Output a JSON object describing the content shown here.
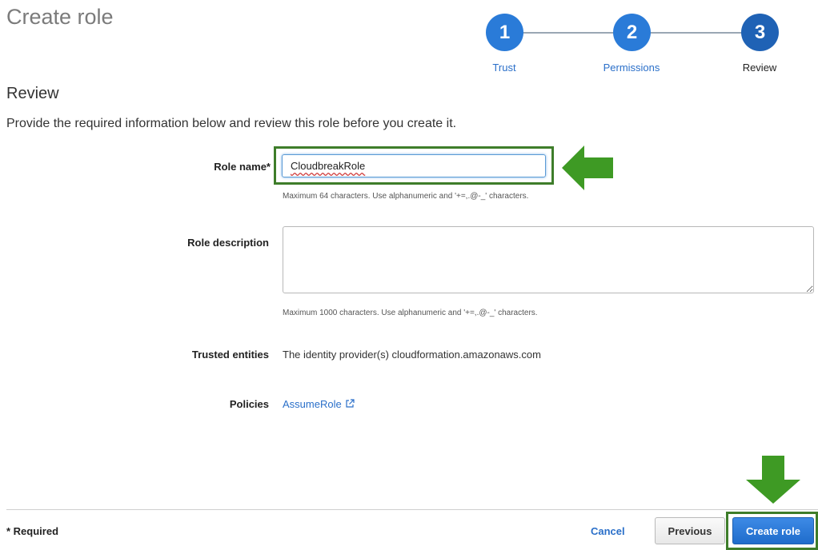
{
  "page": {
    "title": "Create role"
  },
  "stepper": {
    "steps": [
      {
        "number": "1",
        "label": "Trust"
      },
      {
        "number": "2",
        "label": "Permissions"
      },
      {
        "number": "3",
        "label": "Review"
      }
    ]
  },
  "review": {
    "heading": "Review",
    "description": "Provide the required information below and review this role before you create it."
  },
  "form": {
    "role_name": {
      "label": "Role name*",
      "value": "CloudbreakRole",
      "hint": "Maximum 64 characters. Use alphanumeric and '+=,.@-_' characters."
    },
    "role_description": {
      "label": "Role description",
      "value": "",
      "hint": "Maximum 1000 characters. Use alphanumeric and '+=,.@-_' characters."
    },
    "trusted_entities": {
      "label": "Trusted entities",
      "value": "The identity provider(s) cloudformation.amazonaws.com"
    },
    "policies": {
      "label": "Policies",
      "link": "AssumeRole"
    }
  },
  "footer": {
    "required_note": "* Required",
    "cancel_label": "Cancel",
    "previous_label": "Previous",
    "create_label": "Create role"
  },
  "colors": {
    "accent": "#2a7bd8",
    "highlight_green": "#3e9a24"
  }
}
